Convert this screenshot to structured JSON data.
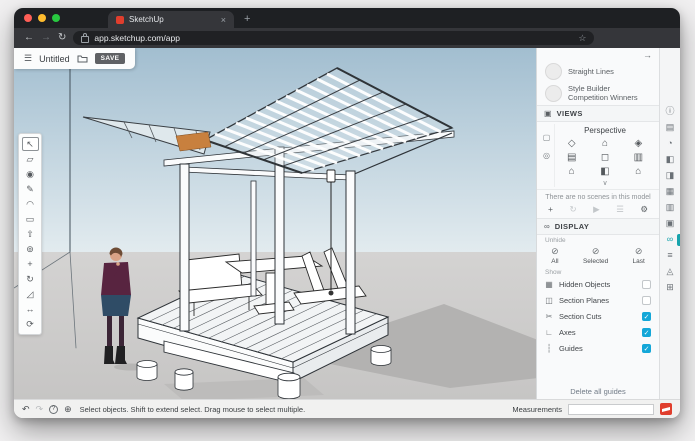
{
  "browser": {
    "tab_title": "SketchUp",
    "tab_close_icon": "×",
    "new_tab_icon": "+",
    "back_icon": "←",
    "forward_icon": "→",
    "reload_icon": "↻",
    "url": "app.sketchup.com/app",
    "bookmark_star_icon": "☆"
  },
  "topbar": {
    "menu_icon": "☰",
    "doc_title": "Untitled",
    "save_label": "SAVE"
  },
  "left_toolbar": {
    "tools": [
      {
        "name": "select",
        "glyph": "↖",
        "active": true
      },
      {
        "name": "eraser",
        "glyph": "▱",
        "active": false
      },
      {
        "name": "paint",
        "glyph": "◉",
        "active": false
      },
      {
        "name": "line",
        "glyph": "✎",
        "active": false
      },
      {
        "name": "arc",
        "glyph": "◠",
        "active": false
      },
      {
        "name": "rectangle",
        "glyph": "▭",
        "active": false
      },
      {
        "name": "push-pull",
        "glyph": "⇧",
        "active": false
      },
      {
        "name": "offset",
        "glyph": "⊚",
        "active": false
      },
      {
        "name": "move",
        "glyph": "+",
        "active": false
      },
      {
        "name": "rotate",
        "glyph": "↻",
        "active": false
      },
      {
        "name": "scale",
        "glyph": "◿",
        "active": false
      },
      {
        "name": "tape-measure",
        "glyph": "↔",
        "active": false
      },
      {
        "name": "orbit",
        "glyph": "⟳",
        "active": false
      }
    ]
  },
  "right_panel": {
    "collapse_icon": "→",
    "styles": {
      "items": [
        {
          "label": "Straight Lines"
        },
        {
          "label": "Style Builder Competition Winners"
        }
      ]
    },
    "views": {
      "header": "VIEWS",
      "header_icon": "▣",
      "side_icons": [
        "▢",
        "◎"
      ],
      "camera_mode": "Perspective",
      "grid_icons": [
        "◇",
        "⌂",
        "◈",
        "▤",
        "◻",
        "▥",
        "⌂",
        "◧",
        "⌂"
      ],
      "expand_icon": "∨"
    },
    "scenes": {
      "empty_text": "There are no scenes in this model",
      "toolbar": [
        {
          "name": "add-scene",
          "glyph": "+",
          "enabled": true
        },
        {
          "name": "update-scene",
          "glyph": "↻",
          "enabled": false
        },
        {
          "name": "play-animation",
          "glyph": "▶",
          "enabled": false
        },
        {
          "name": "scene-list",
          "glyph": "☰",
          "enabled": false
        },
        {
          "name": "scene-settings",
          "glyph": "⚙",
          "enabled": true
        }
      ]
    },
    "display": {
      "header": "DISPLAY",
      "header_icon": "∞",
      "unhide_label": "Unhide",
      "unhide_buttons": [
        {
          "name": "unhide-all",
          "icon": "⊘",
          "label": "All"
        },
        {
          "name": "unhide-selected",
          "icon": "⊘",
          "label": "Selected"
        },
        {
          "name": "unhide-last",
          "icon": "⊘",
          "label": "Last"
        }
      ],
      "show_label": "Show",
      "rows": [
        {
          "name": "hidden-objects",
          "icon": "▦",
          "label": "Hidden Objects",
          "checked": false
        },
        {
          "name": "section-planes",
          "icon": "◫",
          "label": "Section Planes",
          "checked": false
        },
        {
          "name": "section-cuts",
          "icon": "✂",
          "label": "Section Cuts",
          "checked": true
        },
        {
          "name": "axes",
          "icon": "∟",
          "label": "Axes",
          "checked": true
        },
        {
          "name": "guides",
          "icon": "┆",
          "label": "Guides",
          "checked": true
        }
      ],
      "delete_guides_label": "Delete all guides"
    }
  },
  "right_rail": {
    "icons": [
      {
        "name": "entity-info",
        "glyph": "ⓘ",
        "active": false
      },
      {
        "name": "instructor",
        "glyph": "▤",
        "active": false
      },
      {
        "name": "components",
        "glyph": "◔",
        "active": false
      },
      {
        "name": "materials",
        "glyph": "◧",
        "active": false
      },
      {
        "name": "styles",
        "glyph": "◨",
        "active": false
      },
      {
        "name": "tags",
        "glyph": "▦",
        "active": false
      },
      {
        "name": "scenes",
        "glyph": "▥",
        "active": false
      },
      {
        "name": "views",
        "glyph": "▣",
        "active": false
      },
      {
        "name": "display",
        "glyph": "∞",
        "active": true
      },
      {
        "name": "outliner",
        "glyph": "≡",
        "active": false
      },
      {
        "name": "soften-edges",
        "glyph": "◬",
        "active": false
      },
      {
        "name": "model-info",
        "glyph": "⊞",
        "active": false
      }
    ]
  },
  "statusbar": {
    "undo_icon": "↶",
    "redo_icon": "↷",
    "help_icon": "?",
    "language_icon": "⊕",
    "hint": "Select objects. Shift to extend select. Drag mouse to select multiple.",
    "measurements_label": "Measurements",
    "measurements_value": ""
  },
  "colors": {
    "accent_checkbox": "#14a7d8",
    "rail_active_teal": "#17a3ac",
    "sketchup_red": "#e03e2d",
    "traffic_red": "#ff5f57",
    "traffic_yellow": "#febc2e",
    "traffic_green": "#28c840",
    "sky_top": "#a2bed0",
    "sky_bottom": "#e2ebef",
    "ground": "#cbcac9",
    "shadow": "#b3b2b1",
    "roof_accent_orange": "#c8803e"
  }
}
